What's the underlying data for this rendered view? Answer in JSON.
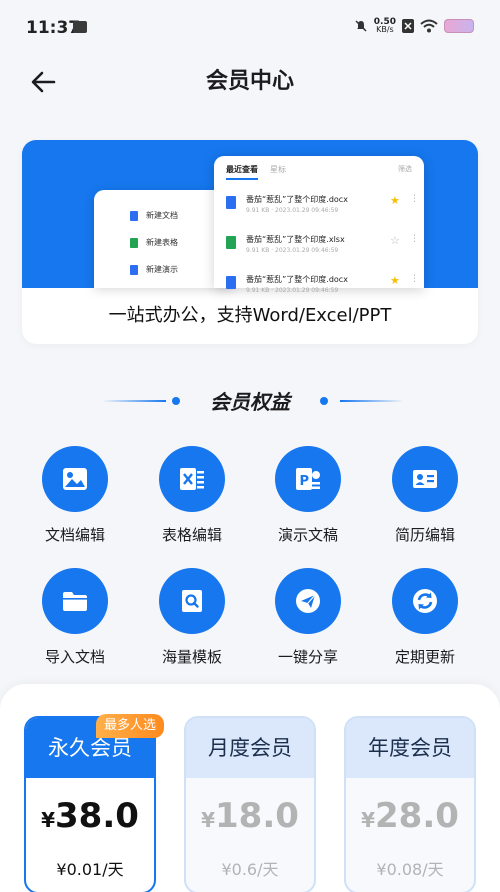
{
  "status": {
    "time": "11:37",
    "speed_value": "0.50",
    "speed_unit": "KB/s"
  },
  "header": {
    "title": "会员中心"
  },
  "banner": {
    "left_menu": [
      {
        "label": "新建文档",
        "color": "#2b6ef2"
      },
      {
        "label": "新建表格",
        "color": "#23a455"
      },
      {
        "label": "新建演示",
        "color": "#2b6ef2"
      }
    ],
    "tabs": {
      "active": "最近查看",
      "inactive": "星标"
    },
    "filter": "筛选",
    "files": [
      {
        "name": "番茄“惹乱”了整个印度.docx",
        "meta": "9.91 KB · 2023.01.29 09:46:59",
        "icon_color": "#2b6ef2",
        "starred": true
      },
      {
        "name": "番茄“惹乱”了整个印度.xlsx",
        "meta": "9.91 KB · 2023.01.29 09:46:59",
        "icon_color": "#23a455",
        "starred": false
      },
      {
        "name": "番茄“惹乱”了整个印度.docx",
        "meta": "9.91 KB · 2023.01.29 09:46:59",
        "icon_color": "#2b6ef2",
        "starred": true
      }
    ],
    "tagline": "一站式办公，支持Word/Excel/PPT"
  },
  "benefits_title": "会员权益",
  "benefits": [
    {
      "label": "文档编辑",
      "icon": "image-icon"
    },
    {
      "label": "表格编辑",
      "icon": "excel-icon"
    },
    {
      "label": "演示文稿",
      "icon": "ppt-icon"
    },
    {
      "label": "简历编辑",
      "icon": "id-card-icon"
    },
    {
      "label": "导入文档",
      "icon": "folder-icon"
    },
    {
      "label": "海量模板",
      "icon": "search-file-icon"
    },
    {
      "label": "一键分享",
      "icon": "send-icon"
    },
    {
      "label": "定期更新",
      "icon": "refresh-icon"
    }
  ],
  "plans": [
    {
      "name": "永久会员",
      "currency": "¥",
      "price": "38.0",
      "unit": "¥0.01/天",
      "selected": true
    },
    {
      "name": "月度会员",
      "currency": "¥",
      "price": "18.0",
      "unit": "¥0.6/天",
      "selected": false
    },
    {
      "name": "年度会员",
      "currency": "¥",
      "price": "28.0",
      "unit": "¥0.08/天",
      "selected": false
    }
  ],
  "badge": "最多人选",
  "colors": {
    "accent": "#1677ee",
    "badge": "#ff9a2e"
  }
}
